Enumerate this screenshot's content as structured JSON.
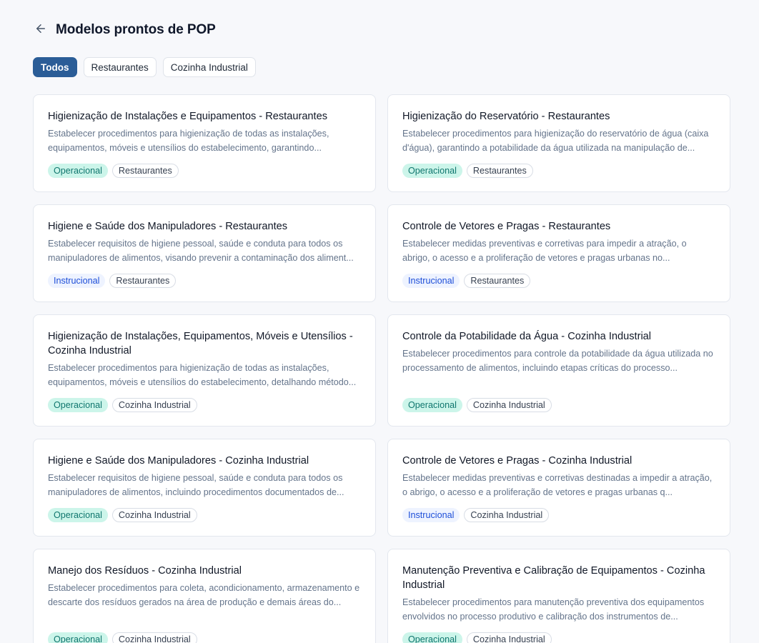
{
  "header": {
    "back_icon": "arrow-left-icon",
    "title": "Modelos prontos de POP"
  },
  "filters": [
    {
      "label": "Todos",
      "active": true
    },
    {
      "label": "Restaurantes",
      "active": false
    },
    {
      "label": "Cozinha Industrial",
      "active": false
    }
  ],
  "cards": [
    {
      "title": "Higienização de Instalações e Equipamentos - Restaurantes",
      "description": "Estabelecer procedimentos para higienização de todas as instalações, equipamentos, móveis e utensílios do estabelecimento, garantindo...",
      "type": "Operacional",
      "category": "Restaurantes"
    },
    {
      "title": "Higienização do Reservatório - Restaurantes",
      "description": "Estabelecer procedimentos para higienização do reservatório de água (caixa d'água), garantindo a potabilidade da água utilizada na manipulação de...",
      "type": "Operacional",
      "category": "Restaurantes"
    },
    {
      "title": "Higiene e Saúde dos Manipuladores - Restaurantes",
      "description": "Estabelecer requisitos de higiene pessoal, saúde e conduta para todos os manipuladores de alimentos, visando prevenir a contaminação dos aliment...",
      "type": "Instrucional",
      "category": "Restaurantes"
    },
    {
      "title": "Controle de Vetores e Pragas - Restaurantes",
      "description": "Estabelecer medidas preventivas e corretivas para impedir a atração, o abrigo, o acesso e a proliferação de vetores e pragas urbanas no...",
      "type": "Instrucional",
      "category": "Restaurantes"
    },
    {
      "title": "Higienização de Instalações, Equipamentos, Móveis e Utensílios - Cozinha Industrial",
      "description": "Estabelecer procedimentos para higienização de todas as instalações, equipamentos, móveis e utensílios do estabelecimento, detalhando método...",
      "type": "Operacional",
      "category": "Cozinha Industrial"
    },
    {
      "title": "Controle da Potabilidade da Água - Cozinha Industrial",
      "description": "Estabelecer procedimentos para controle da potabilidade da água utilizada no processamento de alimentos, incluindo etapas críticas do processo...",
      "type": "Operacional",
      "category": "Cozinha Industrial"
    },
    {
      "title": "Higiene e Saúde dos Manipuladores - Cozinha Industrial",
      "description": "Estabelecer requisitos de higiene pessoal, saúde e conduta para todos os manipuladores de alimentos, incluindo procedimentos documentados de...",
      "type": "Operacional",
      "category": "Cozinha Industrial"
    },
    {
      "title": "Controle de Vetores e Pragas - Cozinha Industrial",
      "description": "Estabelecer medidas preventivas e corretivas destinadas a impedir a atração, o abrigo, o acesso e a proliferação de vetores e pragas urbanas q...",
      "type": "Instrucional",
      "category": "Cozinha Industrial"
    },
    {
      "title": "Manejo dos Resíduos - Cozinha Industrial",
      "description": "Estabelecer procedimentos para coleta, acondicionamento, armazenamento e descarte dos resíduos gerados na área de produção e demais áreas do...",
      "type": "Operacional",
      "category": "Cozinha Industrial"
    },
    {
      "title": "Manutenção Preventiva e Calibração de Equipamentos - Cozinha Industrial",
      "description": "Estabelecer procedimentos para manutenção preventiva dos equipamentos envolvidos no processo produtivo e calibração dos instrumentos de...",
      "type": "Operacional",
      "category": "Cozinha Industrial"
    }
  ],
  "colors": {
    "primary": "#2b5d97",
    "operacional_bg": "#ccf5ea",
    "operacional_text": "#0f766e",
    "instrucional_bg": "#eef3ff",
    "instrucional_text": "#1d4ed8"
  }
}
